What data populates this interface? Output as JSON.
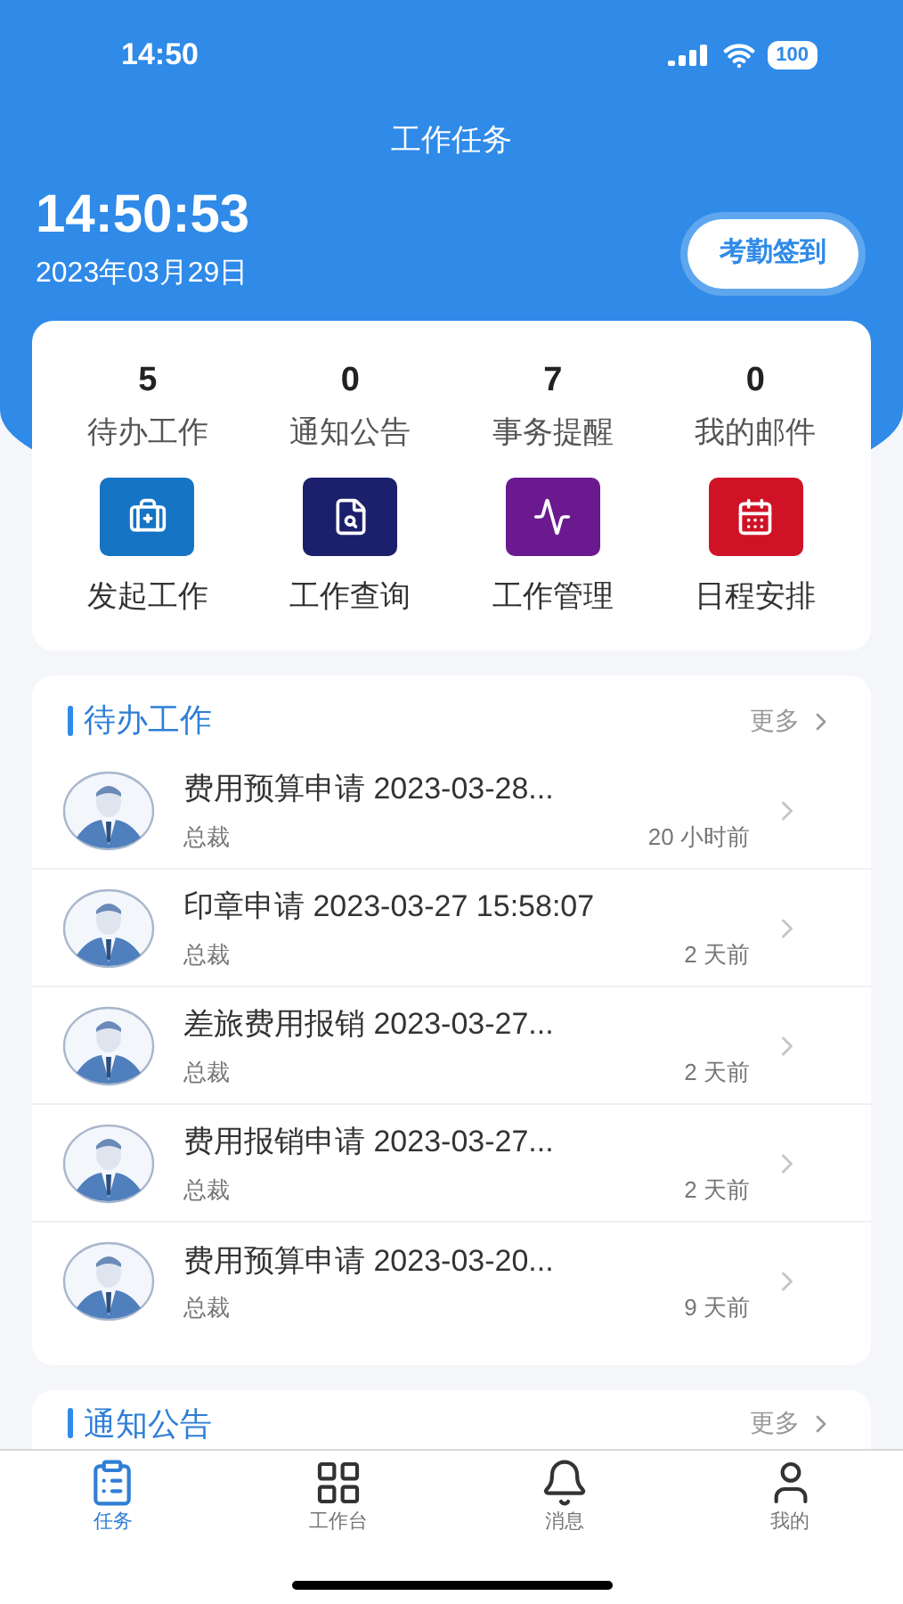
{
  "status_bar": {
    "time": "14:50",
    "battery": "100"
  },
  "header": {
    "title": "工作任务",
    "clock": "14:50:53",
    "date": "2023年03月29日",
    "checkin_button": "考勤签到"
  },
  "stats": [
    {
      "count": "5",
      "label": "待办工作"
    },
    {
      "count": "0",
      "label": "通知公告"
    },
    {
      "count": "7",
      "label": "事务提醒"
    },
    {
      "count": "0",
      "label": "我的邮件"
    }
  ],
  "shortcuts": [
    {
      "kind": "start",
      "label": "发起工作",
      "color": "#1574c4"
    },
    {
      "kind": "query",
      "label": "工作查询",
      "color": "#1c1f6b"
    },
    {
      "kind": "manage",
      "label": "工作管理",
      "color": "#6a1a8e"
    },
    {
      "kind": "schedule",
      "label": "日程安排",
      "color": "#cf1226"
    }
  ],
  "pending": {
    "title": "待办工作",
    "more": "更多",
    "items": [
      {
        "title": "费用预算申请 2023-03-28...",
        "sender": "总裁",
        "time": "20 小时前"
      },
      {
        "title": "印章申请 2023-03-27 15:58:07",
        "sender": "总裁",
        "time": "2 天前"
      },
      {
        "title": "差旅费用报销 2023-03-27...",
        "sender": "总裁",
        "time": "2 天前"
      },
      {
        "title": "费用报销申请 2023-03-27...",
        "sender": "总裁",
        "time": "2 天前"
      },
      {
        "title": "费用预算申请 2023-03-20...",
        "sender": "总裁",
        "time": "9 天前"
      }
    ]
  },
  "notices": {
    "title": "通知公告",
    "more": "更多"
  },
  "tab_bar": [
    {
      "label": "任务",
      "selected": true
    },
    {
      "label": "工作台",
      "selected": false
    },
    {
      "label": "消息",
      "selected": false
    },
    {
      "label": "我的",
      "selected": false
    }
  ]
}
